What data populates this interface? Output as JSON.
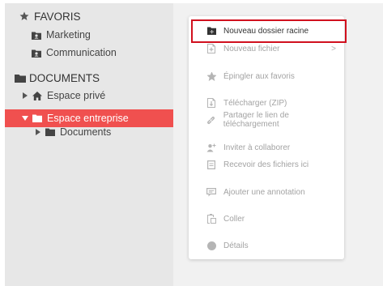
{
  "sidebar": {
    "favorites_header": "FAVORIS",
    "favorites": [
      {
        "label": "Marketing",
        "icon": "shared-folder-icon"
      },
      {
        "label": "Communication",
        "icon": "shared-folder-icon"
      }
    ],
    "documents_header": "DOCUMENTS",
    "tree": [
      {
        "label": "Espace privé",
        "icon": "home-icon",
        "expanded": false
      },
      {
        "label": "Espace entreprise",
        "icon": "folder-icon",
        "expanded": true,
        "selected": true
      },
      {
        "label": "Documents",
        "icon": "folder-icon",
        "expanded": false
      }
    ]
  },
  "context_menu": {
    "items": [
      {
        "label": "Nouveau dossier racine",
        "icon": "new-folder-icon"
      },
      {
        "label": "Nouveau fichier",
        "icon": "new-file-icon",
        "submenu": ">"
      },
      {
        "label": "Épingler aux favoris",
        "icon": "star-icon"
      },
      {
        "label": "Télécharger (ZIP)",
        "icon": "download-icon"
      },
      {
        "label": "Partager le lien de téléchargement",
        "icon": "link-icon"
      },
      {
        "label": "Inviter à collaborer",
        "icon": "add-user-icon"
      },
      {
        "label": "Recevoir des fichiers ici",
        "icon": "inbox-icon"
      },
      {
        "label": "Ajouter une annotation",
        "icon": "comment-icon"
      },
      {
        "label": "Coller",
        "icon": "paste-icon"
      },
      {
        "label": "Détails",
        "icon": "info-icon"
      }
    ]
  },
  "colors": {
    "sidebar_bg": "#e7e7e7",
    "active_bg": "#f0504f",
    "highlight": "#d1101e"
  }
}
